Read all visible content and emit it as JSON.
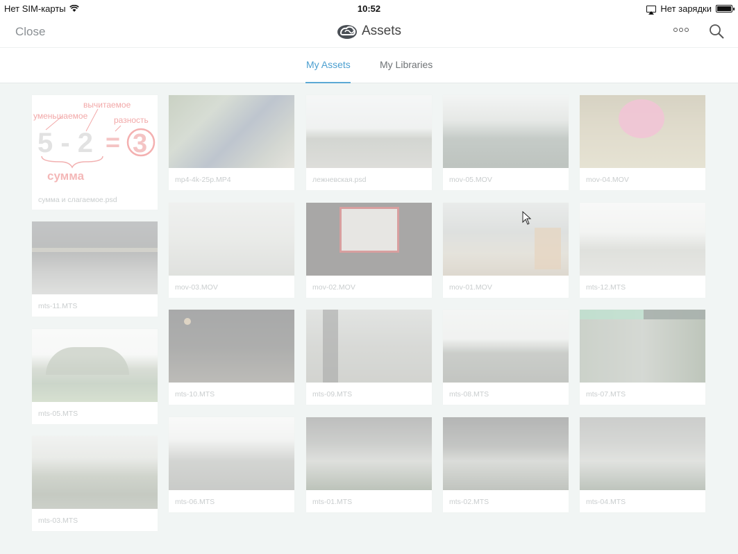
{
  "status_bar": {
    "carrier": "Нет SIM-карты",
    "time": "10:52",
    "charging": "Нет зарядки"
  },
  "nav": {
    "close_label": "Close",
    "title": "Assets"
  },
  "tabs": [
    {
      "label": "My Assets",
      "active": true
    },
    {
      "label": "My Libraries",
      "active": false
    }
  ],
  "math_thumbnail": {
    "subtrahend_label": "вычитаемое",
    "minuend_label": "уменьшаемое",
    "difference_label": "разность",
    "equation_left": "5 - 2",
    "equals": "=",
    "result": "3",
    "sum_label": "сумма"
  },
  "assets": [
    {
      "name": "сумма и слагаемое.psd"
    },
    {
      "name": "mp4-4k-25p.MP4"
    },
    {
      "name": "лежневская.psd"
    },
    {
      "name": "mov-05.MOV"
    },
    {
      "name": "mov-04.MOV"
    },
    {
      "name": "mts-11.MTS"
    },
    {
      "name": "mov-03.MOV"
    },
    {
      "name": "mov-02.MOV"
    },
    {
      "name": "mov-01.MOV"
    },
    {
      "name": "mts-12.MTS"
    },
    {
      "name": "mts-05.MTS"
    },
    {
      "name": "mts-10.MTS"
    },
    {
      "name": "mts-09.MTS"
    },
    {
      "name": "mts-08.MTS"
    },
    {
      "name": "mts-07.MTS"
    },
    {
      "name": "mts-03.MTS"
    },
    {
      "name": "mts-06.MTS"
    },
    {
      "name": "mts-01.MTS"
    },
    {
      "name": "mts-02.MTS"
    },
    {
      "name": "mts-04.MTS"
    }
  ],
  "icons": {
    "wifi": "wifi-icon",
    "airplay": "airplay-icon",
    "battery": "battery-icon",
    "logo": "creative-cloud-logo-icon",
    "more": "more-options-icon",
    "search": "search-icon",
    "cursor": "mouse-cursor-icon"
  },
  "colors": {
    "accent": "#4b9fd0",
    "background": "#f1f5f4"
  },
  "battery_level": 1.0
}
